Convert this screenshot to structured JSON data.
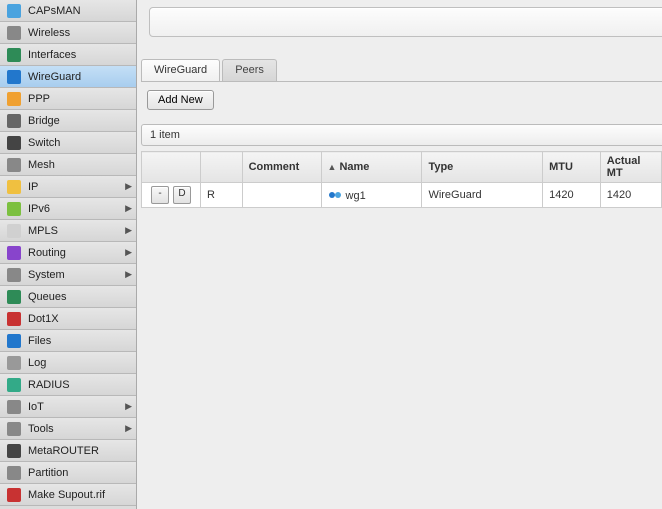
{
  "sidebar": {
    "items": [
      {
        "label": "CAPsMAN",
        "hasSubmenu": false,
        "color": "#4aa3df"
      },
      {
        "label": "Wireless",
        "hasSubmenu": false,
        "color": "#888"
      },
      {
        "label": "Interfaces",
        "hasSubmenu": false,
        "color": "#2e8b57"
      },
      {
        "label": "WireGuard",
        "hasSubmenu": false,
        "color": "#2277cc",
        "active": true
      },
      {
        "label": "PPP",
        "hasSubmenu": false,
        "color": "#f0a030"
      },
      {
        "label": "Bridge",
        "hasSubmenu": false,
        "color": "#666"
      },
      {
        "label": "Switch",
        "hasSubmenu": false,
        "color": "#444"
      },
      {
        "label": "Mesh",
        "hasSubmenu": false,
        "color": "#888"
      },
      {
        "label": "IP",
        "hasSubmenu": true,
        "color": "#f0c040"
      },
      {
        "label": "IPv6",
        "hasSubmenu": true,
        "color": "#7cc040"
      },
      {
        "label": "MPLS",
        "hasSubmenu": true,
        "color": "#d0d0d0"
      },
      {
        "label": "Routing",
        "hasSubmenu": true,
        "color": "#8844cc"
      },
      {
        "label": "System",
        "hasSubmenu": true,
        "color": "#888"
      },
      {
        "label": "Queues",
        "hasSubmenu": false,
        "color": "#2e8b57"
      },
      {
        "label": "Dot1X",
        "hasSubmenu": false,
        "color": "#c83232"
      },
      {
        "label": "Files",
        "hasSubmenu": false,
        "color": "#2277cc"
      },
      {
        "label": "Log",
        "hasSubmenu": false,
        "color": "#999"
      },
      {
        "label": "RADIUS",
        "hasSubmenu": false,
        "color": "#3a8"
      },
      {
        "label": "IoT",
        "hasSubmenu": true,
        "color": "#888"
      },
      {
        "label": "Tools",
        "hasSubmenu": true,
        "color": "#888"
      },
      {
        "label": "MetaROUTER",
        "hasSubmenu": false,
        "color": "#444"
      },
      {
        "label": "Partition",
        "hasSubmenu": false,
        "color": "#888"
      },
      {
        "label": "Make Supout.rif",
        "hasSubmenu": false,
        "color": "#c83232"
      }
    ]
  },
  "tabs": {
    "wireguard": "WireGuard",
    "peers": "Peers"
  },
  "actions": {
    "add_new": "Add New"
  },
  "status": {
    "item_count_text": "1 item"
  },
  "table": {
    "headers": {
      "comment": "Comment",
      "name": "Name",
      "type": "Type",
      "mtu": "MTU",
      "actual_mtu": "Actual MT"
    },
    "row_actions": {
      "minus": "-",
      "d": "D"
    },
    "rows": [
      {
        "flag": "R",
        "comment": "",
        "name": "wg1",
        "type": "WireGuard",
        "mtu": "1420",
        "actual_mtu": "1420"
      }
    ]
  }
}
